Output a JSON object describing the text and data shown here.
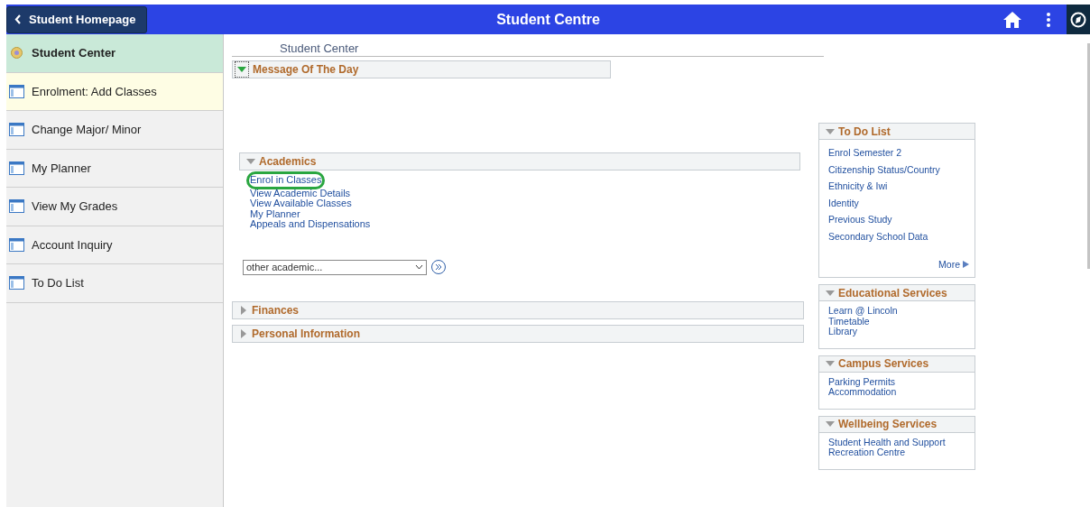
{
  "header": {
    "back_button": "Student Homepage",
    "title": "Student Centre"
  },
  "sidebar": {
    "items": [
      {
        "label": "Student Center",
        "kind": "hub",
        "selected": true,
        "hovered": false
      },
      {
        "label": "Enrolment:  Add Classes",
        "kind": "page",
        "selected": false,
        "hovered": true
      },
      {
        "label": "Change Major/ Minor",
        "kind": "page",
        "selected": false,
        "hovered": false
      },
      {
        "label": "My Planner",
        "kind": "page",
        "selected": false,
        "hovered": false
      },
      {
        "label": "View My Grades",
        "kind": "page",
        "selected": false,
        "hovered": false
      },
      {
        "label": "Account Inquiry",
        "kind": "page",
        "selected": false,
        "hovered": false
      },
      {
        "label": "To Do List",
        "kind": "page",
        "selected": false,
        "hovered": false
      }
    ]
  },
  "page_title": "Student Center",
  "message_of_the_day": {
    "title": "Message Of The Day",
    "expanded": true
  },
  "sections": [
    {
      "title": "Academics",
      "expanded": true,
      "links": [
        {
          "label": "Enrol in Classes",
          "highlighted": true
        },
        {
          "label": "View Academic Details",
          "highlighted": false
        },
        {
          "label": "View Available Classes",
          "highlighted": false
        },
        {
          "label": "My Planner",
          "highlighted": false
        },
        {
          "label": "Appeals and Dispensations",
          "highlighted": false
        }
      ],
      "dropdown": "other academic..."
    },
    {
      "title": "Finances",
      "expanded": false
    },
    {
      "title": "Personal Information",
      "expanded": false
    }
  ],
  "right_panels": [
    {
      "title": "To Do List",
      "kind": "spaced",
      "links": [
        "Enrol Semester 2",
        "Citizenship Status/Country",
        "Ethnicity & Iwi",
        "Identity",
        "Previous Study",
        "Secondary School Data"
      ],
      "more": "More"
    },
    {
      "title": "Educational Services",
      "kind": "compact",
      "links": [
        "Learn @ Lincoln",
        "Timetable",
        "Library"
      ]
    },
    {
      "title": "Campus Services",
      "kind": "compact",
      "links": [
        "Parking Permits",
        "Accommodation"
      ]
    },
    {
      "title": "Wellbeing Services",
      "kind": "compact",
      "links": [
        "Student Health and Support",
        "Recreation Centre"
      ]
    }
  ]
}
